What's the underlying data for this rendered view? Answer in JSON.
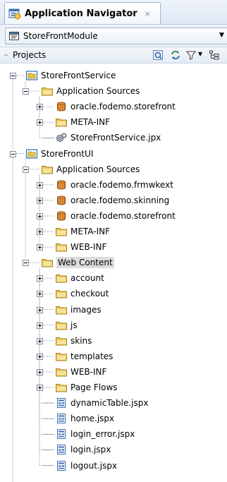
{
  "panel": {
    "title": "Application Navigator",
    "close_glyph": "×",
    "icon": "application-navigator-icon"
  },
  "module_selector": {
    "value": "StoreFrontModule",
    "icon": "module-icon"
  },
  "projects_header": {
    "label": "Projects",
    "tools": [
      "refresh-icon",
      "sync-icon",
      "filter-icon",
      "layout-icon"
    ]
  },
  "tree": [
    {
      "label": "StoreFrontService",
      "icon": "project-icon",
      "expander": "minus"
    },
    {
      "label": "Application Sources",
      "icon": "folder-icon",
      "expander": "minus"
    },
    {
      "label": "oracle.fodemo.storefront",
      "icon": "package-icon",
      "expander": "plus"
    },
    {
      "label": "META-INF",
      "icon": "folder-icon",
      "expander": "plus"
    },
    {
      "label": "StoreFrontService.jpx",
      "icon": "jpx-file-icon",
      "expander": "none"
    },
    {
      "label": "StoreFrontUI",
      "icon": "project-icon",
      "expander": "minus"
    },
    {
      "label": "Application Sources",
      "icon": "folder-icon",
      "expander": "minus"
    },
    {
      "label": "oracle.fodemo.frmwkext",
      "icon": "package-icon",
      "expander": "plus"
    },
    {
      "label": "oracle.fodemo.skinning",
      "icon": "package-icon",
      "expander": "plus"
    },
    {
      "label": "oracle.fodemo.storefront",
      "icon": "package-icon",
      "expander": "plus"
    },
    {
      "label": "META-INF",
      "icon": "folder-icon",
      "expander": "plus"
    },
    {
      "label": "WEB-INF",
      "icon": "folder-icon",
      "expander": "plus"
    },
    {
      "label": "Web Content",
      "icon": "folder-icon",
      "expander": "minus",
      "selected": true
    },
    {
      "label": "account",
      "icon": "folder-icon",
      "expander": "plus"
    },
    {
      "label": "checkout",
      "icon": "folder-icon",
      "expander": "plus"
    },
    {
      "label": "images",
      "icon": "folder-icon",
      "expander": "plus"
    },
    {
      "label": "js",
      "icon": "folder-icon",
      "expander": "plus"
    },
    {
      "label": "skins",
      "icon": "folder-icon",
      "expander": "plus"
    },
    {
      "label": "templates",
      "icon": "folder-icon",
      "expander": "plus"
    },
    {
      "label": "WEB-INF",
      "icon": "folder-icon",
      "expander": "plus"
    },
    {
      "label": "Page Flows",
      "icon": "folder-icon",
      "expander": "plus"
    },
    {
      "label": "dynamicTable.jspx",
      "icon": "jspx-file-icon",
      "expander": "none"
    },
    {
      "label": "home.jspx",
      "icon": "jspx-file-icon",
      "expander": "none"
    },
    {
      "label": "login_error.jspx",
      "icon": "jspx-file-icon",
      "expander": "none"
    },
    {
      "label": "login.jspx",
      "icon": "jspx-file-icon",
      "expander": "none"
    },
    {
      "label": "logout.jspx",
      "icon": "jspx-file-icon",
      "expander": "none"
    }
  ],
  "colors": {
    "folder": "#e8c34a",
    "package": "#c8731e",
    "project_border": "#2f6fbf",
    "selection": "#dcdcdc"
  }
}
